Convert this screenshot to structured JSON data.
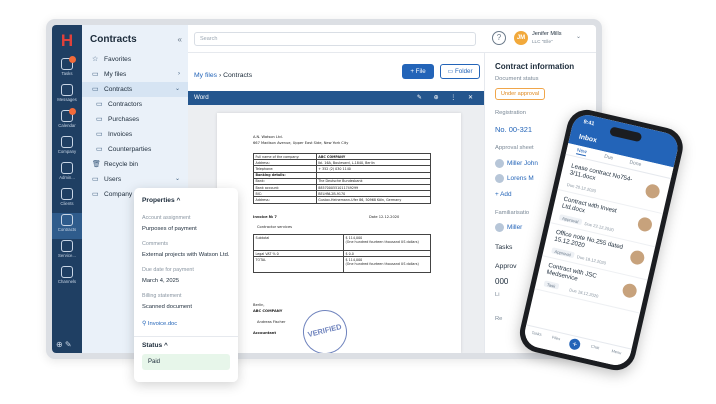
{
  "rail": {
    "logo": "H",
    "items": [
      {
        "label": "Tasks"
      },
      {
        "label": "Messages"
      },
      {
        "label": "Calendar"
      },
      {
        "label": "Company"
      },
      {
        "label": "Admin..."
      },
      {
        "label": "Clients"
      },
      {
        "label": "Contracts"
      },
      {
        "label": "Service..."
      },
      {
        "label": "Channels"
      }
    ]
  },
  "sidebar": {
    "title": "Contracts",
    "collapse": "«",
    "items": [
      {
        "label": "Favorites",
        "icon": "☆"
      },
      {
        "label": "My files",
        "icon": "▭",
        "chev": "›"
      },
      {
        "label": "Contracts",
        "icon": "▭",
        "chev": "⌄"
      },
      {
        "label": "Contractors",
        "icon": "▭"
      },
      {
        "label": "Purchases",
        "icon": "▭"
      },
      {
        "label": "Invoices",
        "icon": "▭"
      },
      {
        "label": "Counterparties",
        "icon": "▭"
      },
      {
        "label": "Recycle bin",
        "icon": "🗑"
      },
      {
        "label": "Users",
        "icon": "▭",
        "chev": "⌄"
      },
      {
        "label": "Company fil",
        "icon": "▭"
      }
    ]
  },
  "topbar": {
    "search_placeholder": "Search",
    "help": "?",
    "avatar_initials": "JM",
    "user_name": "Jenifer Mills",
    "user_org": "LLC \"Elle\"",
    "user_chev": "⌄"
  },
  "main": {
    "crumb_parent": "My files",
    "crumb_sep": "›",
    "crumb_current": "Contracts",
    "file_button": "+ File",
    "folder_button": "Folder",
    "viewer_title": "Word",
    "viewer_icons": "✎ ⊕ ⋮ ✕"
  },
  "document": {
    "sender": "A.N. Watson Ltd.",
    "sender_address": "667 Madison Avenue, Upper East Side, New York City",
    "table": [
      [
        "Full name of the company:",
        "ABC COMPANY"
      ],
      [
        "Address:",
        "Ibl. 16A, Boulevard, L-1840, Berlin"
      ],
      [
        "Telephone:",
        "+ 352 (2) 030 1140"
      ],
      [
        "Banking details:",
        ""
      ],
      [
        "Bank:",
        "The Deutsche Bundesbank"
      ],
      [
        "Bank account:",
        "8857000551011749299"
      ],
      [
        "BIC:",
        "BELHNL2B-9170"
      ],
      [
        "Address:",
        "Gustav-Heinemann-Ufer 86, 50968 Köln, Germany"
      ]
    ],
    "invoice_no": "Invoice № 7",
    "invoice_date": "Date 12.12.2020",
    "services": "Contractor services",
    "totals": [
      [
        "Subtotal",
        "$ 114,000\n(One hundred fourteen thousand US dollars)"
      ],
      [
        "Legal VAT % 0",
        "$ 0.0"
      ],
      [
        "TOTAL",
        "$ 114,000\n(One hundred fourteen thousand US dollars)"
      ]
    ],
    "sign_city": "Berlin,",
    "sign_company": "ABC COMPANY",
    "sign_person": "Andreas Fischer",
    "sign_role": "Accountant",
    "stamp": "VERIFIED"
  },
  "right_panel": {
    "title": "Contract information",
    "document_status_label": "Document status",
    "document_status": "Under approval",
    "registration_label": "Registration",
    "registration_value": "No. 00-321",
    "approval_sheet_label": "Approval sheet",
    "approvers": [
      "Miller John",
      "Lorens M"
    ],
    "add": "+ Add",
    "familiarisation_label": "Familiarisatio",
    "familiar_person": "Miller",
    "tasks": "Tasks",
    "approval_short": "Approv",
    "big_value": "000",
    "li": "Li",
    "re": "Re"
  },
  "properties": {
    "title": "Properties",
    "collapse": "^",
    "account_label": "Account assignment",
    "account_value": "Purposes of payment",
    "comments_label": "Comments",
    "comments_value": "External projects with Watson Ltd.",
    "due_label": "Due date for payment",
    "due_value": "March 4, 2025",
    "billing_label": "Billing statement",
    "billing_value": "Scanned document",
    "attachment": "Invoice.doc",
    "status_title": "Status",
    "status_value": "Paid"
  },
  "phone": {
    "time": "9:41",
    "title": "Inbox",
    "tabs": [
      "New",
      "Due",
      "Done"
    ],
    "items": [
      {
        "title": "Lease contract No754-3/11.docx",
        "due": "Due 20.12.2020"
      },
      {
        "title": "Contract with Invest Ltd.docx",
        "tag": "Approval",
        "due": "Due 22.12.2020"
      },
      {
        "title": "Office note No.255 dated 15.12.2020",
        "tag": "Approval",
        "due": "Due 18.12.2020"
      },
      {
        "title": "Contract with JSC Medservice",
        "tag": "Task",
        "due": "Due 18.12.2020"
      }
    ],
    "bottom": [
      "Tasks",
      "Files",
      "+",
      "Chat",
      "Menu"
    ]
  }
}
